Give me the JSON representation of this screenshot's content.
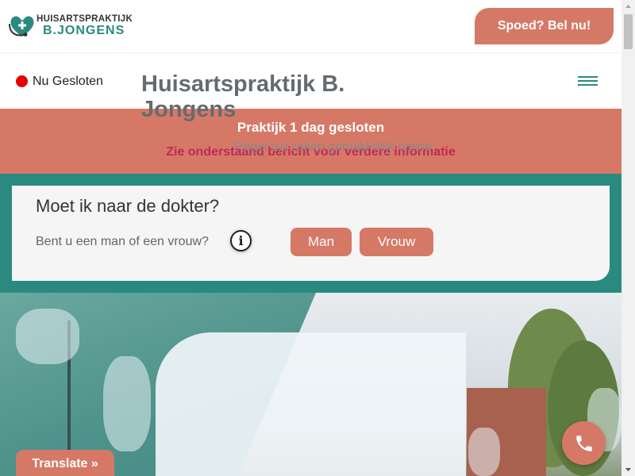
{
  "header": {
    "logo_line1": "HUISARTSPRAKTIJK",
    "logo_line2": "B.JONGENS",
    "emergency_button": "Spoed? Bel nu!",
    "logo_icon": "stethoscope-heart-icon"
  },
  "status": {
    "label": "Nu Gesloten",
    "dot_color": "#e60000",
    "menu_icon": "hamburger-icon"
  },
  "notice": {
    "title": "Praktijk 1 dag gesloten",
    "subtitle": "Zie onderstaand bericht voor verdere informatie"
  },
  "triage": {
    "title": "Moet ik naar de dokter?",
    "question": "Bent u een man of een vrouw?",
    "info_icon": "info-icon",
    "options": [
      "Man",
      "Vrouw"
    ]
  },
  "hero": {
    "title": "Huisartspraktijk B. Jongens",
    "subtitle": "Regel uw zaken gemakkelijk online:"
  },
  "floating": {
    "translate_label": "Translate »",
    "phone_icon": "phone-icon"
  },
  "colors": {
    "accent": "#d57966",
    "teal": "#2a8a80",
    "notice_sub": "#c2285a"
  }
}
